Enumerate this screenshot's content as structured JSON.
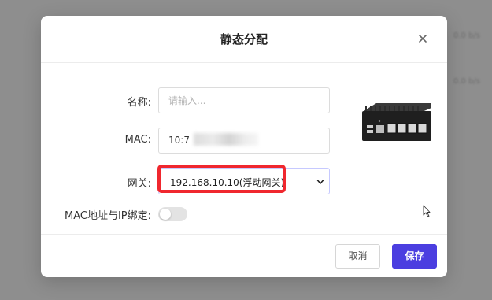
{
  "background": {
    "hint_top": "0.0 b/s",
    "hint_mid": "0.0 b/s"
  },
  "dialog": {
    "title": "静态分配",
    "close_icon": "close-icon",
    "fields": {
      "name_label": "名称:",
      "name_placeholder": "请输入...",
      "name_value": "",
      "mac_label": "MAC:",
      "mac_value_visible": "10:7",
      "gateway_label": "网关:",
      "gateway_value": "192.168.10.10(浮动网关)",
      "binding_label": "MAC地址与IP绑定:",
      "binding_enabled": false
    },
    "device_image": "mini-pc-router-icon",
    "buttons": {
      "cancel": "取消",
      "save": "保存"
    }
  },
  "colors": {
    "accent": "#4b3ee0",
    "highlight": "#f0272e",
    "overlay": "#8e8e8e"
  }
}
